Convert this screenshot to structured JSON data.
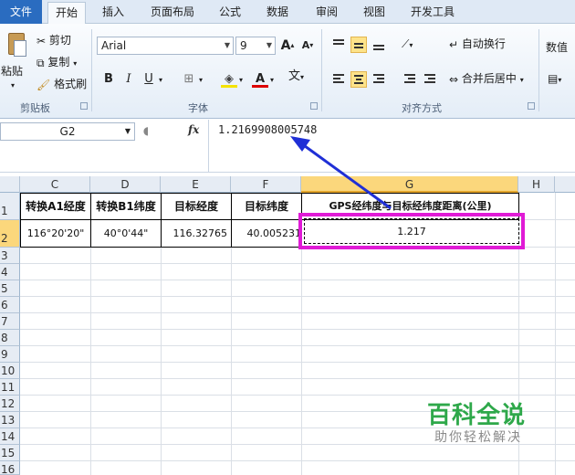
{
  "ribbon_tabs": [
    "文件",
    "开始",
    "插入",
    "页面布局",
    "公式",
    "数据",
    "审阅",
    "视图",
    "开发工具"
  ],
  "clipboard": {
    "paste": "粘贴",
    "cut": "剪切",
    "copy": "复制",
    "format_painter": "格式刷",
    "group_label": "剪贴板"
  },
  "font": {
    "name": "Arial",
    "size": "9",
    "bold": "B",
    "italic": "I",
    "underline": "U",
    "grow": "A",
    "shrink": "A",
    "font_color": "A",
    "phonetic": "wén",
    "group_label": "字体"
  },
  "alignment": {
    "wrap_text": "自动换行",
    "merge_center": "合并后居中",
    "group_label": "对齐方式"
  },
  "number": {
    "format": "数值"
  },
  "formula_bar": {
    "name_box": "G2",
    "fx": "fx",
    "content": "1.2169908005748"
  },
  "columns": [
    "C",
    "D",
    "E",
    "F",
    "G",
    "H"
  ],
  "rows": [
    "1",
    "2",
    "3",
    "4",
    "5",
    "6",
    "7",
    "8",
    "9",
    "10",
    "11",
    "12",
    "13",
    "14",
    "15",
    "16"
  ],
  "table": {
    "headers": [
      "转换A1经度",
      "转换B1纬度",
      "目标经度",
      "目标纬度",
      "GPS经纬度与目标经纬度距离(公里)"
    ],
    "row2": [
      "116°20'20\"",
      "40°0'44\"",
      "116.32765",
      "40.005231",
      "1.217"
    ]
  },
  "selected_cell": "G2",
  "colors": {
    "highlight": "#e01bd6",
    "arrow": "#1f2fd6",
    "selected_header": "#fbd77c",
    "file_tab": "#2a6cc0"
  },
  "watermark": {
    "title": "百科全说",
    "subtitle": "助你轻松解决"
  }
}
